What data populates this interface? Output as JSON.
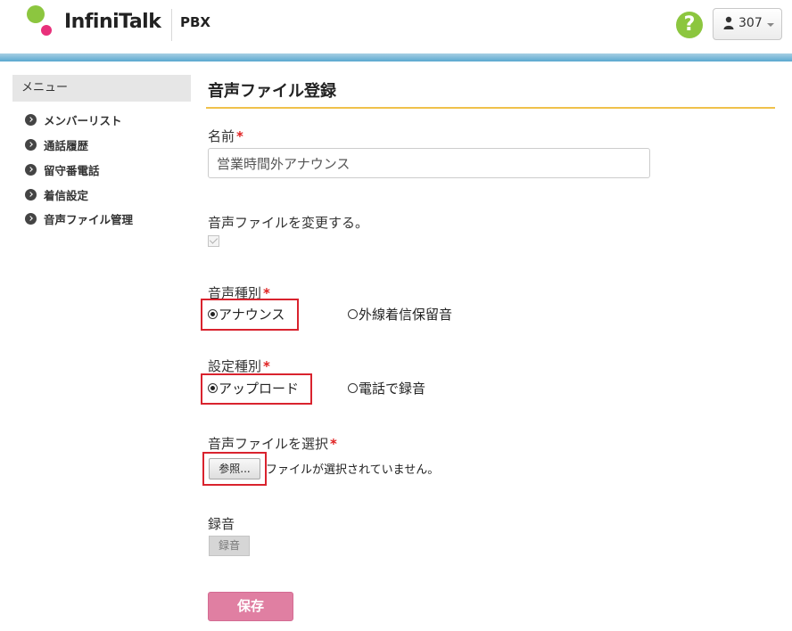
{
  "header": {
    "brand": "InfiniTalk",
    "product": "PBX",
    "help_label": "?",
    "user_label": "307",
    "colors": {
      "brand_green": "#8cc63f",
      "brand_pink": "#e8307a",
      "top_bar": "#5aa8d0"
    }
  },
  "sidebar": {
    "title": "メニュー",
    "items": [
      {
        "label": "メンバーリスト"
      },
      {
        "label": "通話履歴"
      },
      {
        "label": "留守番電話"
      },
      {
        "label": "着信設定"
      },
      {
        "label": "音声ファイル管理"
      }
    ]
  },
  "main": {
    "title": "音声ファイル登録",
    "name_field": {
      "label": "名前",
      "required_mark": "*",
      "value": "営業時間外アナウンス"
    },
    "change_file": {
      "label": "音声ファイルを変更する。",
      "checked": true,
      "disabled": true
    },
    "voice_type": {
      "label": "音声種別",
      "required_mark": "*",
      "options": [
        {
          "label": "アナウンス",
          "selected": true
        },
        {
          "label": "外線着信保留音",
          "selected": false
        }
      ]
    },
    "setting_type": {
      "label": "設定種別",
      "required_mark": "*",
      "options": [
        {
          "label": "アップロード",
          "selected": true
        },
        {
          "label": "電話で録音",
          "selected": false
        }
      ]
    },
    "file_select": {
      "label": "音声ファイルを選択",
      "required_mark": "*",
      "browse_label": "参照...",
      "status": "ファイルが選択されていません。"
    },
    "recording": {
      "label": "録音",
      "button_label": "録音"
    },
    "save_label": "保存"
  }
}
